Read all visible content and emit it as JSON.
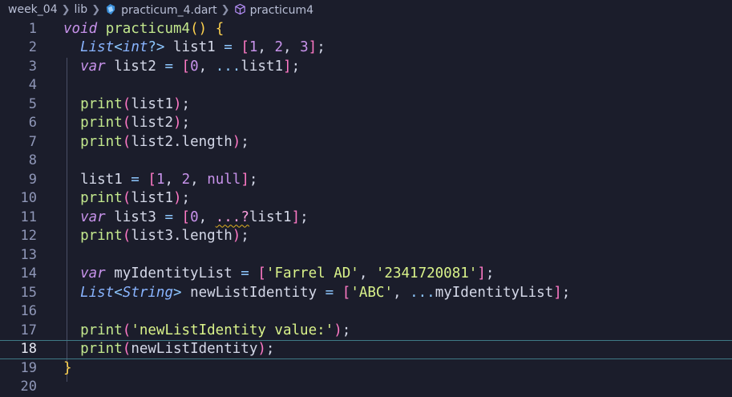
{
  "breadcrumb": {
    "folder1": "week_04",
    "folder2": "lib",
    "file": "practicum_4.dart",
    "symbol": "practicum4"
  },
  "lines": [
    {
      "n": "1",
      "tokens": [
        [
          "k",
          "void"
        ],
        [
          "id",
          " "
        ],
        [
          "fn",
          "practicum4"
        ],
        [
          "p1",
          "()"
        ],
        [
          "id",
          " "
        ],
        [
          "p1",
          "{"
        ]
      ]
    },
    {
      "n": "2",
      "tokens": [
        [
          "id",
          "  "
        ],
        [
          "t",
          "List"
        ],
        [
          "op",
          "<"
        ],
        [
          "t",
          "int"
        ],
        [
          "op",
          "?>"
        ],
        [
          "id",
          " list1 "
        ],
        [
          "op",
          "="
        ],
        [
          "id",
          " "
        ],
        [
          "p2",
          "["
        ],
        [
          "num",
          "1"
        ],
        [
          "id",
          ", "
        ],
        [
          "num",
          "2"
        ],
        [
          "id",
          ", "
        ],
        [
          "num",
          "3"
        ],
        [
          "p2",
          "]"
        ],
        [
          "id",
          ";"
        ]
      ]
    },
    {
      "n": "3",
      "tokens": [
        [
          "id",
          "  "
        ],
        [
          "k",
          "var"
        ],
        [
          "id",
          " list2 "
        ],
        [
          "op",
          "="
        ],
        [
          "id",
          " "
        ],
        [
          "p2",
          "["
        ],
        [
          "num",
          "0"
        ],
        [
          "id",
          ", "
        ],
        [
          "op",
          "..."
        ],
        [
          "id",
          "list1"
        ],
        [
          "p2",
          "]"
        ],
        [
          "id",
          ";"
        ]
      ]
    },
    {
      "n": "4",
      "tokens": []
    },
    {
      "n": "5",
      "tokens": [
        [
          "id",
          "  "
        ],
        [
          "fn",
          "print"
        ],
        [
          "p2",
          "("
        ],
        [
          "id",
          "list1"
        ],
        [
          "p2",
          ")"
        ],
        [
          "id",
          ";"
        ]
      ]
    },
    {
      "n": "6",
      "tokens": [
        [
          "id",
          "  "
        ],
        [
          "fn",
          "print"
        ],
        [
          "p2",
          "("
        ],
        [
          "id",
          "list2"
        ],
        [
          "p2",
          ")"
        ],
        [
          "id",
          ";"
        ]
      ]
    },
    {
      "n": "7",
      "tokens": [
        [
          "id",
          "  "
        ],
        [
          "fn",
          "print"
        ],
        [
          "p2",
          "("
        ],
        [
          "id",
          "list2.length"
        ],
        [
          "p2",
          ")"
        ],
        [
          "id",
          ";"
        ]
      ]
    },
    {
      "n": "8",
      "tokens": []
    },
    {
      "n": "9",
      "tokens": [
        [
          "id",
          "  list1 "
        ],
        [
          "op",
          "="
        ],
        [
          "id",
          " "
        ],
        [
          "p2",
          "["
        ],
        [
          "num",
          "1"
        ],
        [
          "id",
          ", "
        ],
        [
          "num",
          "2"
        ],
        [
          "id",
          ", "
        ],
        [
          "num",
          "null"
        ],
        [
          "p2",
          "]"
        ],
        [
          "id",
          ";"
        ]
      ]
    },
    {
      "n": "10",
      "tokens": [
        [
          "id",
          "  "
        ],
        [
          "fn",
          "print"
        ],
        [
          "p2",
          "("
        ],
        [
          "id",
          "list1"
        ],
        [
          "p2",
          ")"
        ],
        [
          "id",
          ";"
        ]
      ]
    },
    {
      "n": "11",
      "tokens": [
        [
          "id",
          "  "
        ],
        [
          "k",
          "var"
        ],
        [
          "id",
          " list3 "
        ],
        [
          "op",
          "="
        ],
        [
          "id",
          " "
        ],
        [
          "p2",
          "["
        ],
        [
          "num",
          "0"
        ],
        [
          "id",
          ", "
        ],
        [
          "sp",
          "...?"
        ],
        [
          "id",
          "list1"
        ],
        [
          "p2",
          "]"
        ],
        [
          "id",
          ";"
        ]
      ]
    },
    {
      "n": "12",
      "tokens": [
        [
          "id",
          "  "
        ],
        [
          "fn",
          "print"
        ],
        [
          "p2",
          "("
        ],
        [
          "id",
          "list3.length"
        ],
        [
          "p2",
          ")"
        ],
        [
          "id",
          ";"
        ]
      ]
    },
    {
      "n": "13",
      "tokens": []
    },
    {
      "n": "14",
      "tokens": [
        [
          "id",
          "  "
        ],
        [
          "k",
          "var"
        ],
        [
          "id",
          " myIdentityList "
        ],
        [
          "op",
          "="
        ],
        [
          "id",
          " "
        ],
        [
          "p2",
          "["
        ],
        [
          "str",
          "'Farrel AD'"
        ],
        [
          "id",
          ", "
        ],
        [
          "str",
          "'2341720081'"
        ],
        [
          "p2",
          "]"
        ],
        [
          "id",
          ";"
        ]
      ]
    },
    {
      "n": "15",
      "tokens": [
        [
          "id",
          "  "
        ],
        [
          "t",
          "List"
        ],
        [
          "op",
          "<"
        ],
        [
          "t",
          "String"
        ],
        [
          "op",
          ">"
        ],
        [
          "id",
          " newListIdentity "
        ],
        [
          "op",
          "="
        ],
        [
          "id",
          " "
        ],
        [
          "p2",
          "["
        ],
        [
          "str",
          "'ABC'"
        ],
        [
          "id",
          ", "
        ],
        [
          "op",
          "..."
        ],
        [
          "id",
          "myIdentityList"
        ],
        [
          "p2",
          "]"
        ],
        [
          "id",
          ";"
        ]
      ]
    },
    {
      "n": "16",
      "tokens": []
    },
    {
      "n": "17",
      "tokens": [
        [
          "id",
          "  "
        ],
        [
          "fn",
          "print"
        ],
        [
          "p2",
          "("
        ],
        [
          "str",
          "'newListIdentity value:'"
        ],
        [
          "p2",
          ")"
        ],
        [
          "id",
          ";"
        ]
      ]
    },
    {
      "n": "18",
      "tokens": [
        [
          "id",
          "  "
        ],
        [
          "fn",
          "print"
        ],
        [
          "p2",
          "("
        ],
        [
          "id",
          "newListIdentity"
        ],
        [
          "p2",
          ")"
        ],
        [
          "id",
          ";"
        ]
      ]
    },
    {
      "n": "19",
      "tokens": [
        [
          "p1",
          "}"
        ]
      ]
    },
    {
      "n": "20",
      "tokens": []
    }
  ],
  "active_line": "18",
  "colors": {
    "background": "#1b1d2b",
    "keyword": "#c792ea",
    "type": "#89b4ff",
    "function": "#c3e88d",
    "string": "#d9f28a",
    "bracket_outer": "#ffd34e",
    "bracket_inner": "#ff79c6"
  },
  "icons": [
    "dart-file-icon",
    "symbol-method-icon",
    "chevron-right-icon"
  ]
}
